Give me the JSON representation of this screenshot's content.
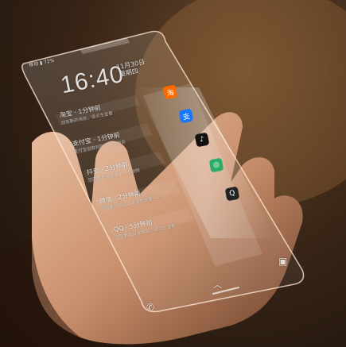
{
  "status": {
    "left": "移动 ▮ 72%",
    "carrier": ""
  },
  "lock": {
    "time": "16:40",
    "date": "11月30日",
    "weekday": "星期四"
  },
  "notifications": [
    {
      "title": "淘宝 · 1分钟前",
      "body": "您有新的消息，请点击查看"
    },
    {
      "title": "支付宝 · 1分钟前",
      "body": "支付宝收款到账了一个消息"
    },
    {
      "title": "抖音 · 2分钟前",
      "body": "您的朋友给你发了一个视频"
    },
    {
      "title": "微信 · 2分钟前",
      "body": "您有新的消息，请点击查看一个"
    },
    {
      "title": "QQ · 5分钟前",
      "body": "您有新的好友消息，请点击查看"
    }
  ],
  "icons": [
    {
      "name": "taobao-icon",
      "glyph": "淘",
      "color": "#ff6a00"
    },
    {
      "name": "alipay-icon",
      "glyph": "支",
      "color": "#1677ff"
    },
    {
      "name": "tiktok-icon",
      "glyph": "♪",
      "color": "#111111"
    },
    {
      "name": "wechat-icon",
      "glyph": "◎",
      "color": "#2aae67"
    },
    {
      "name": "qq-icon",
      "glyph": "Q",
      "color": "#222222"
    }
  ],
  "bottom": {
    "phone": "✆",
    "camera": "▣",
    "swipe": "︿"
  }
}
